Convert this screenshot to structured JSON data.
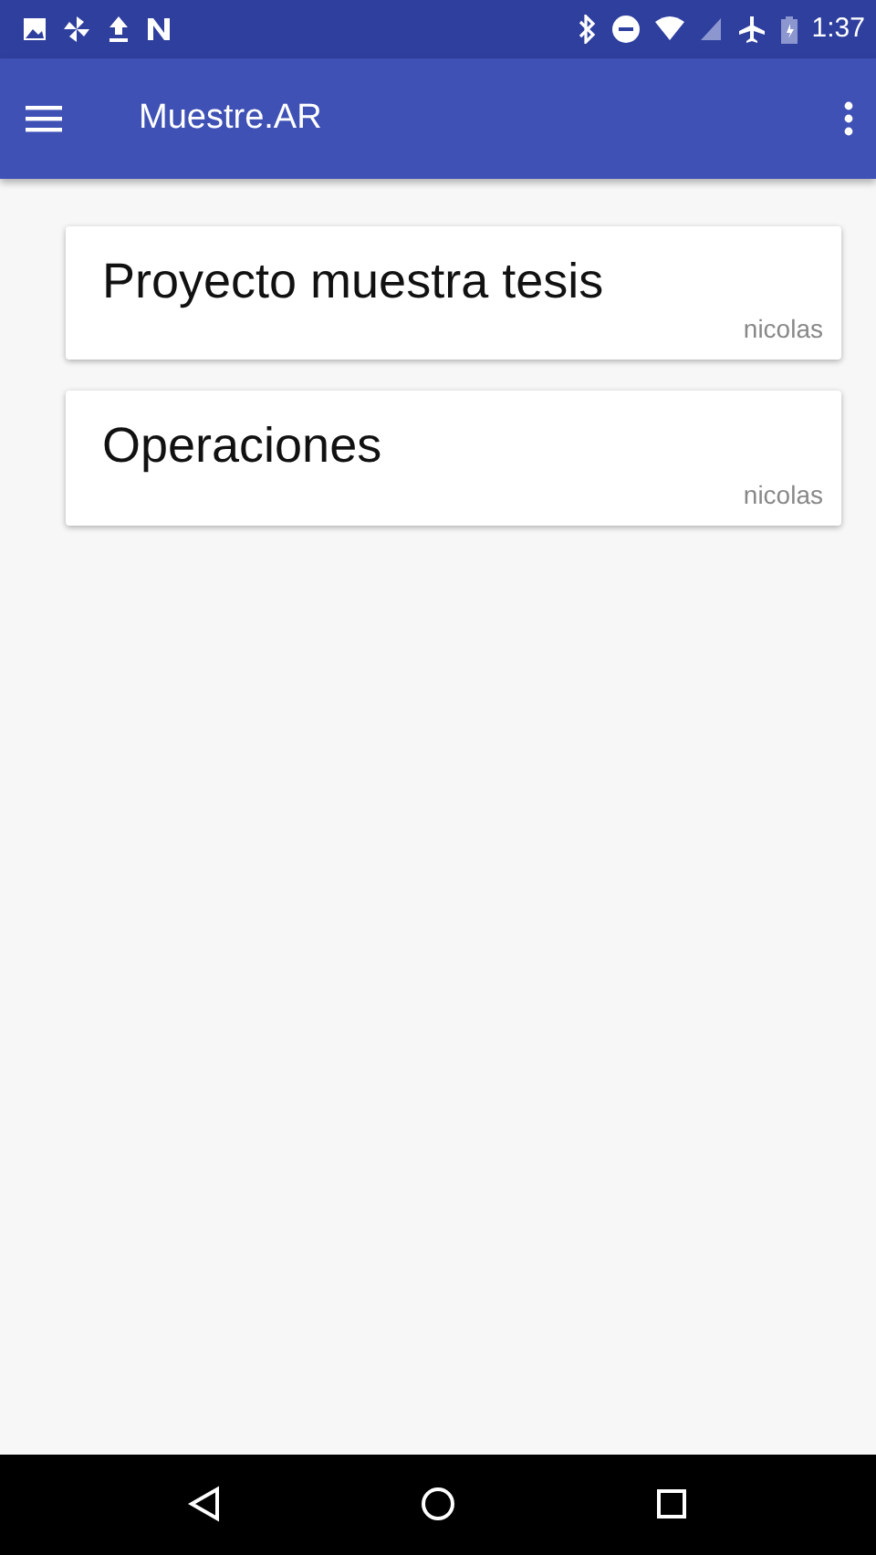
{
  "status_bar": {
    "time": "1:37"
  },
  "app_bar": {
    "title": "Muestre.AR"
  },
  "projects": [
    {
      "title": "Proyecto muestra tesis",
      "owner": "nicolas"
    },
    {
      "title": "Operaciones",
      "owner": "nicolas"
    }
  ]
}
